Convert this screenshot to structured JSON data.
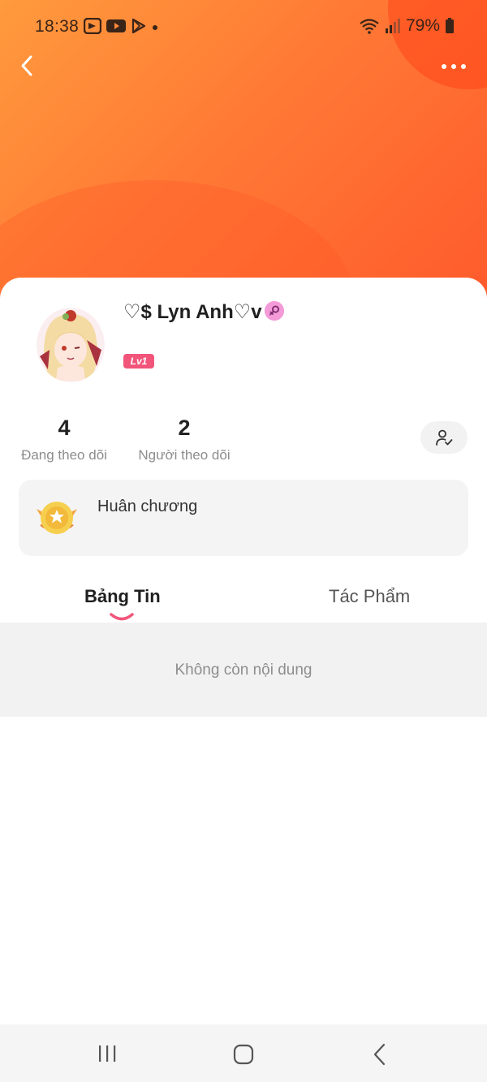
{
  "status_bar": {
    "time": "18:38",
    "battery": "79%",
    "notification_icons": [
      "app-notification-icon",
      "youtube-icon",
      "play-store-icon"
    ],
    "right_icons": [
      "wifi-icon",
      "signal-icon",
      "battery-icon"
    ]
  },
  "header": {
    "back_icon": "chevron-left-icon",
    "more_icon": "more-dots-icon",
    "accent_color": "#ff6a33"
  },
  "profile": {
    "name": "♡$ Lyn Anh♡v",
    "gender_icon": "female-icon",
    "level": "Lv1",
    "level_color": "#f2557a"
  },
  "stats": {
    "following_count": "4",
    "following_label": "Đang theo dõi",
    "followers_count": "2",
    "followers_label": "Người theo dõi"
  },
  "follow_button": {
    "icon": "user-check-icon"
  },
  "medal": {
    "label": "Huân chương",
    "icon": "medal-icon"
  },
  "tabs": [
    {
      "label": "Bảng Tin",
      "active": true
    },
    {
      "label": "Tác Phẩm",
      "active": false
    }
  ],
  "feed": {
    "empty_text": "Không còn nội dung"
  },
  "nav_bar": {
    "icons": [
      "recent-apps-icon",
      "home-icon",
      "back-icon"
    ]
  }
}
